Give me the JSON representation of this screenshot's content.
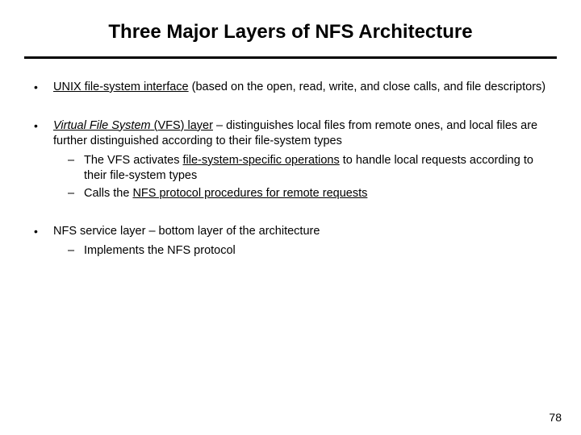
{
  "title": "Three Major Layers of NFS Architecture",
  "bullets": [
    {
      "segments": [
        {
          "text": "UNIX file-system interface",
          "underline": true,
          "italic": false
        },
        {
          "text": " (based on the open, read, write, and close calls, and file descriptors)",
          "underline": false,
          "italic": false
        }
      ],
      "sub": []
    },
    {
      "segments": [
        {
          "text": "Virtual File System",
          "underline": true,
          "italic": true
        },
        {
          "text": " (VFS) layer",
          "underline": true,
          "italic": false
        },
        {
          "text": " – distinguishes local files from remote ones, and local files are further distinguished according to their file-system types",
          "underline": false,
          "italic": false
        }
      ],
      "sub": [
        {
          "segments": [
            {
              "text": "The VFS activates ",
              "underline": false,
              "italic": false
            },
            {
              "text": "file-system-specific operations",
              "underline": true,
              "italic": false
            },
            {
              "text": " to handle local requests according to their file-system types",
              "underline": false,
              "italic": false
            }
          ]
        },
        {
          "segments": [
            {
              "text": "Calls the ",
              "underline": false,
              "italic": false
            },
            {
              "text": "NFS protocol procedures for remote requests",
              "underline": true,
              "italic": false
            }
          ]
        }
      ]
    },
    {
      "segments": [
        {
          "text": "NFS service layer – bottom layer of the architecture",
          "underline": false,
          "italic": false
        }
      ],
      "sub": [
        {
          "segments": [
            {
              "text": "Implements the NFS protocol",
              "underline": false,
              "italic": false
            }
          ]
        }
      ]
    }
  ],
  "page_number": "78"
}
